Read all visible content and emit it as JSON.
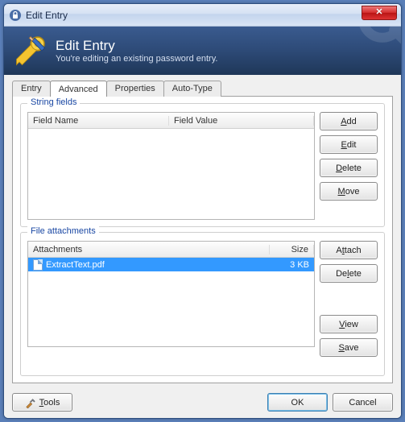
{
  "window": {
    "title": "Edit Entry"
  },
  "header": {
    "title": "Edit Entry",
    "subtitle": "You're editing an existing password entry."
  },
  "tabs": {
    "entry": "Entry",
    "advanced": "Advanced",
    "properties": "Properties",
    "autotype": "Auto-Type"
  },
  "string_fields": {
    "legend": "String fields",
    "col_name": "Field Name",
    "col_value": "Field Value",
    "rows": [],
    "btn_add": "Add",
    "btn_edit": "Edit",
    "btn_delete": "Delete",
    "btn_move": "Move"
  },
  "attachments": {
    "legend": "File attachments",
    "col_name": "Attachments",
    "col_size": "Size",
    "rows": [
      {
        "name": "ExtractText.pdf",
        "size": "3 KB",
        "selected": true
      }
    ],
    "btn_attach": "Attach",
    "btn_delete": "Delete",
    "btn_view": "View",
    "btn_save": "Save"
  },
  "footer": {
    "tools": "Tools",
    "ok": "OK",
    "cancel": "Cancel"
  }
}
